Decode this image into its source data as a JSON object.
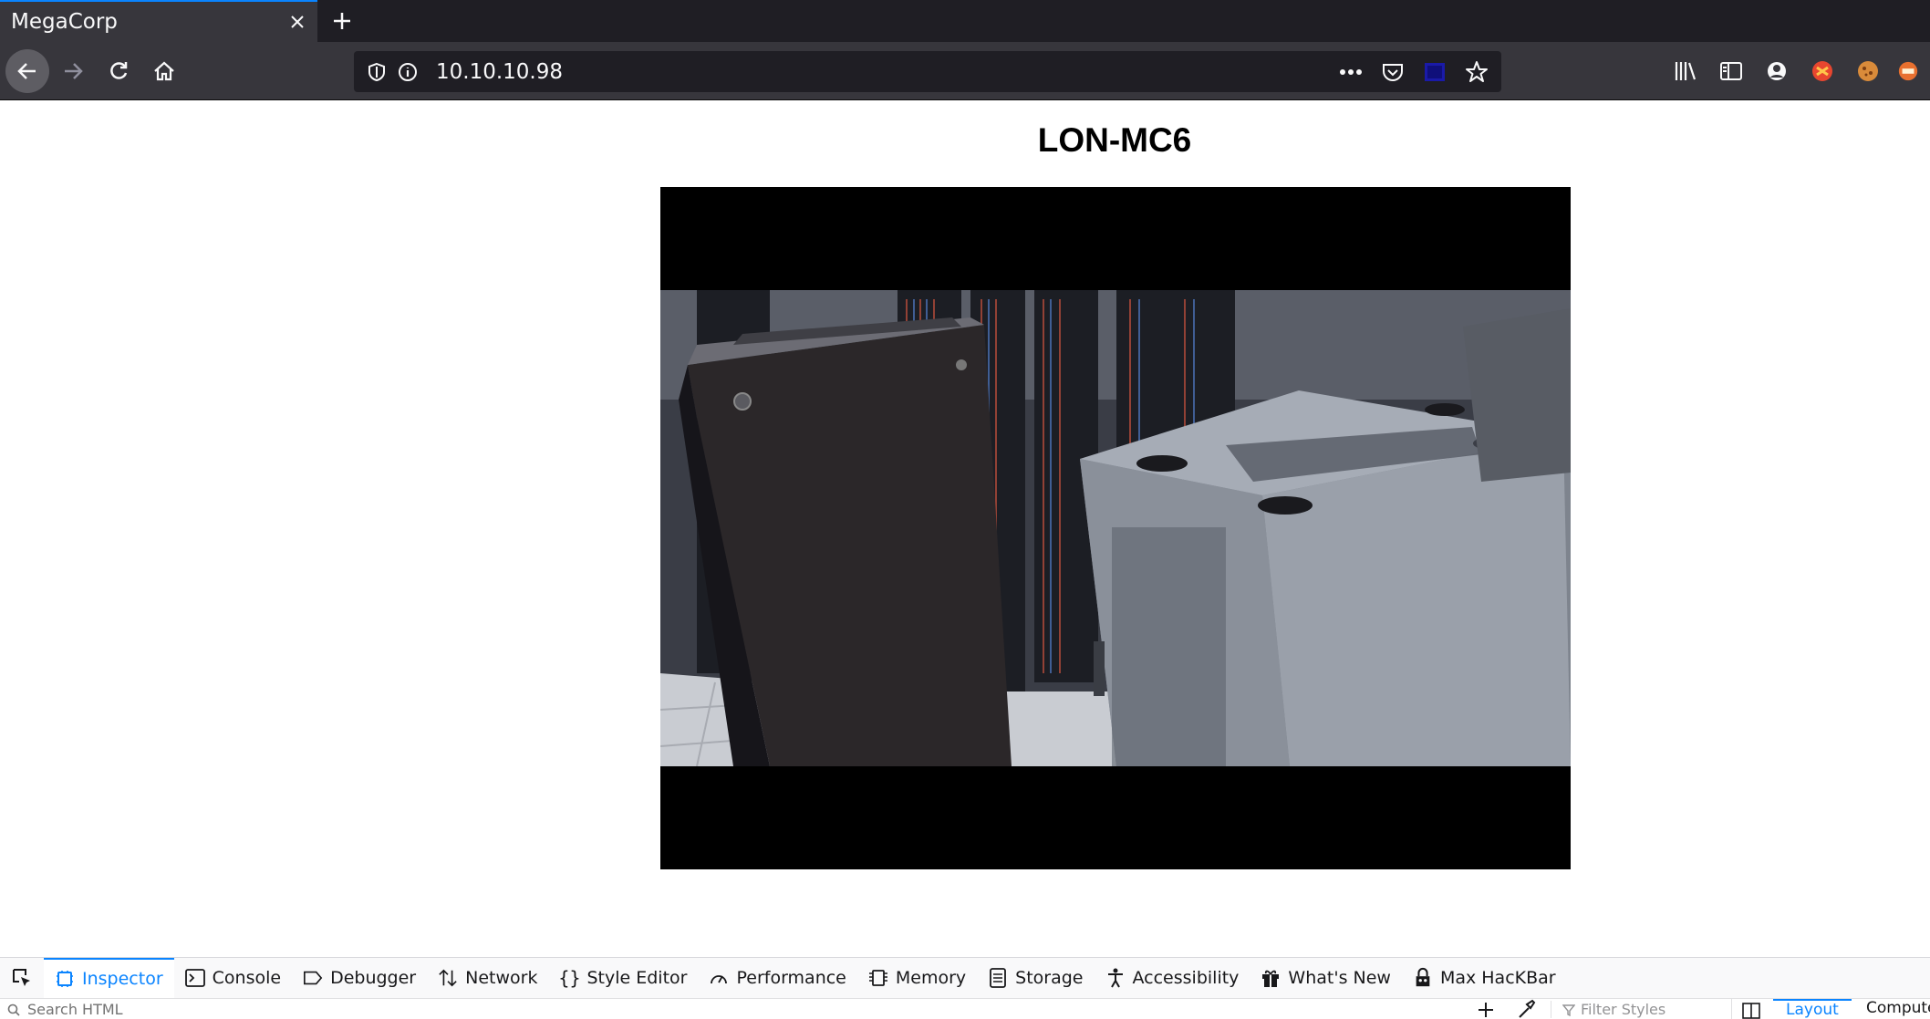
{
  "browser": {
    "tab_title": "MegaCorp",
    "url": "10.10.10.98"
  },
  "page": {
    "title": "LON-MC6"
  },
  "devtools": {
    "tabs": [
      {
        "label": "Inspector",
        "icon": "inspector-icon",
        "active": true
      },
      {
        "label": "Console",
        "icon": "console-icon"
      },
      {
        "label": "Debugger",
        "icon": "debugger-icon"
      },
      {
        "label": "Network",
        "icon": "network-icon"
      },
      {
        "label": "Style Editor",
        "icon": "style-editor-icon"
      },
      {
        "label": "Performance",
        "icon": "performance-icon"
      },
      {
        "label": "Memory",
        "icon": "memory-icon"
      },
      {
        "label": "Storage",
        "icon": "storage-icon"
      },
      {
        "label": "Accessibility",
        "icon": "accessibility-icon"
      },
      {
        "label": "What's New",
        "icon": "gift-icon"
      },
      {
        "label": "Max HacKBar",
        "icon": "hackbar-icon"
      }
    ],
    "search_placeholder": "Search HTML",
    "filter_placeholder": "Filter Styles",
    "right_tabs": {
      "layout": "Layout",
      "computed": "Computed"
    }
  },
  "colors": {
    "chrome_dark": "#1f1e24",
    "chrome": "#37363c",
    "accent": "#0a84ff"
  }
}
